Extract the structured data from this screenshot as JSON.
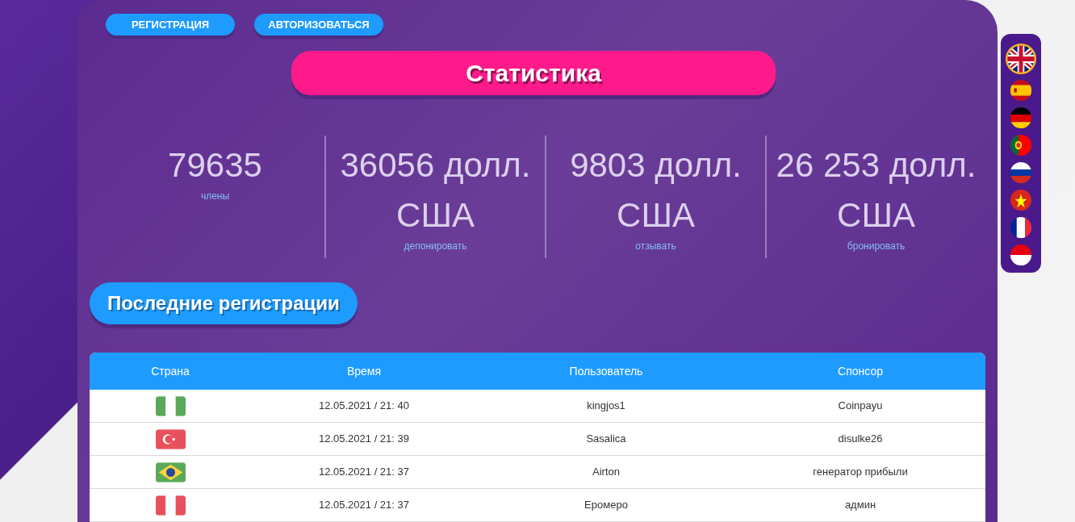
{
  "auth_buttons": [
    "РЕГИСТРАЦИЯ",
    "АВТОРИЗОВАТЬСЯ"
  ],
  "stats_title": "Статистика",
  "stats": [
    {
      "value": "79635",
      "label": "члены"
    },
    {
      "value": "36056 долл. США",
      "label": "депонировать"
    },
    {
      "value": "9803 долл. США",
      "label": "отзывать"
    },
    {
      "value": "26 253 долл. США",
      "label": "бронировать"
    }
  ],
  "registrations_title": "Последние регистрации",
  "table": {
    "columns": [
      "Страна",
      "Время",
      "Пользователь",
      "Спонсор"
    ],
    "rows": [
      {
        "kind": "ng",
        "time": "12.05.2021 / 21: 40",
        "user": "kingjos1",
        "sponsor": "Coinpayu"
      },
      {
        "kind": "tr",
        "time": "12.05.2021 / 21: 39",
        "user": "Sasalica",
        "sponsor": "disulke26"
      },
      {
        "kind": "br",
        "time": "12.05.2021 / 21: 37",
        "user": "Airton",
        "sponsor": "генератор прибыли"
      },
      {
        "kind": "pe",
        "time": "12.05.2021 / 21: 37",
        "user": "Еромеро",
        "sponsor": "админ"
      }
    ]
  },
  "languages": [
    {
      "kind": "gb",
      "selected": true
    },
    {
      "kind": "es",
      "selected": false
    },
    {
      "kind": "de",
      "selected": false
    },
    {
      "kind": "pt",
      "selected": false
    },
    {
      "kind": "ru",
      "selected": false
    },
    {
      "kind": "vn",
      "selected": false
    },
    {
      "kind": "fr",
      "selected": false
    },
    {
      "kind": "id",
      "selected": false
    }
  ]
}
